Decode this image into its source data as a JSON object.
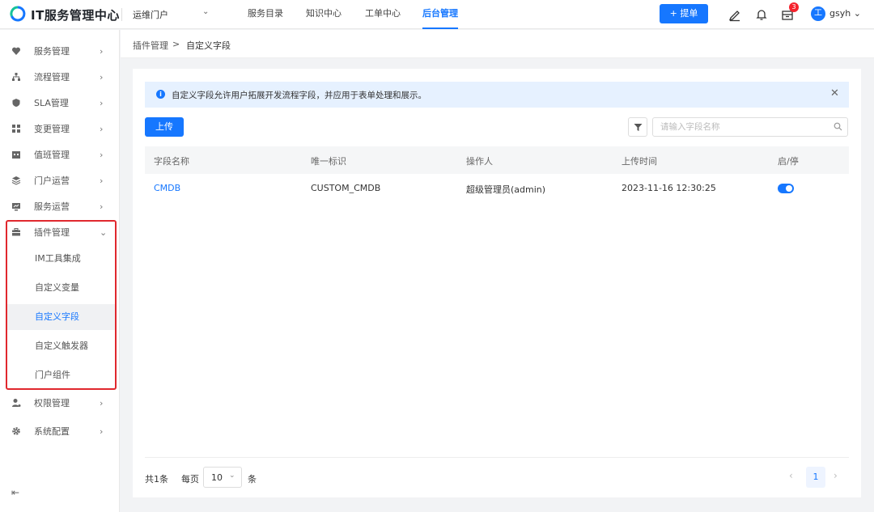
{
  "app": {
    "title": "IT服务管理中心",
    "portal": "运维门户"
  },
  "topnav": [
    {
      "label": "服务目录"
    },
    {
      "label": "知识中心"
    },
    {
      "label": "工单中心"
    },
    {
      "label": "后台管理",
      "active": true
    }
  ],
  "header": {
    "submit_label": "+ 提单",
    "notification_badge": "3",
    "avatar_letter": "工",
    "username": "gsyh"
  },
  "sidebar": {
    "items": [
      {
        "label": "服务管理",
        "icon": "heart-icon"
      },
      {
        "label": "流程管理",
        "icon": "flow-icon"
      },
      {
        "label": "SLA管理",
        "icon": "shield-icon"
      },
      {
        "label": "变更管理",
        "icon": "grid-icon"
      },
      {
        "label": "值班管理",
        "icon": "calendar-icon"
      },
      {
        "label": "门户运营",
        "icon": "layers-icon"
      },
      {
        "label": "服务运营",
        "icon": "chart-icon"
      },
      {
        "label": "插件管理",
        "icon": "briefcase-icon",
        "expanded": true
      },
      {
        "label": "权限管理",
        "icon": "user-icon"
      },
      {
        "label": "系统配置",
        "icon": "gear-icon"
      }
    ],
    "plugin_children": [
      {
        "label": "IM工具集成"
      },
      {
        "label": "自定义变量"
      },
      {
        "label": "自定义字段",
        "active": true
      },
      {
        "label": "自定义触发器"
      },
      {
        "label": "门户组件"
      }
    ]
  },
  "breadcrumb": {
    "parent": "插件管理",
    "separator": ">",
    "current": "自定义字段"
  },
  "alert": {
    "text": "自定义字段允许用户拓展开发流程字段，并应用于表单处理和展示。"
  },
  "toolbar": {
    "upload_label": "上传",
    "search_placeholder": "请输入字段名称"
  },
  "table": {
    "columns": [
      "字段名称",
      "唯一标识",
      "操作人",
      "上传时间",
      "启/停"
    ],
    "rows": [
      {
        "name": "CMDB",
        "key": "CUSTOM_CMDB",
        "operator": "超级管理员(admin)",
        "time": "2023-11-16 12:30:25",
        "enabled": true
      }
    ]
  },
  "pagination": {
    "total": "共1条",
    "per_page_label": "每页",
    "page_size": "10",
    "unit": "条",
    "current_page": "1"
  },
  "colors": {
    "accent": "#1677ff",
    "highlight_box": "#e0282e",
    "badge": "#f5222d"
  }
}
